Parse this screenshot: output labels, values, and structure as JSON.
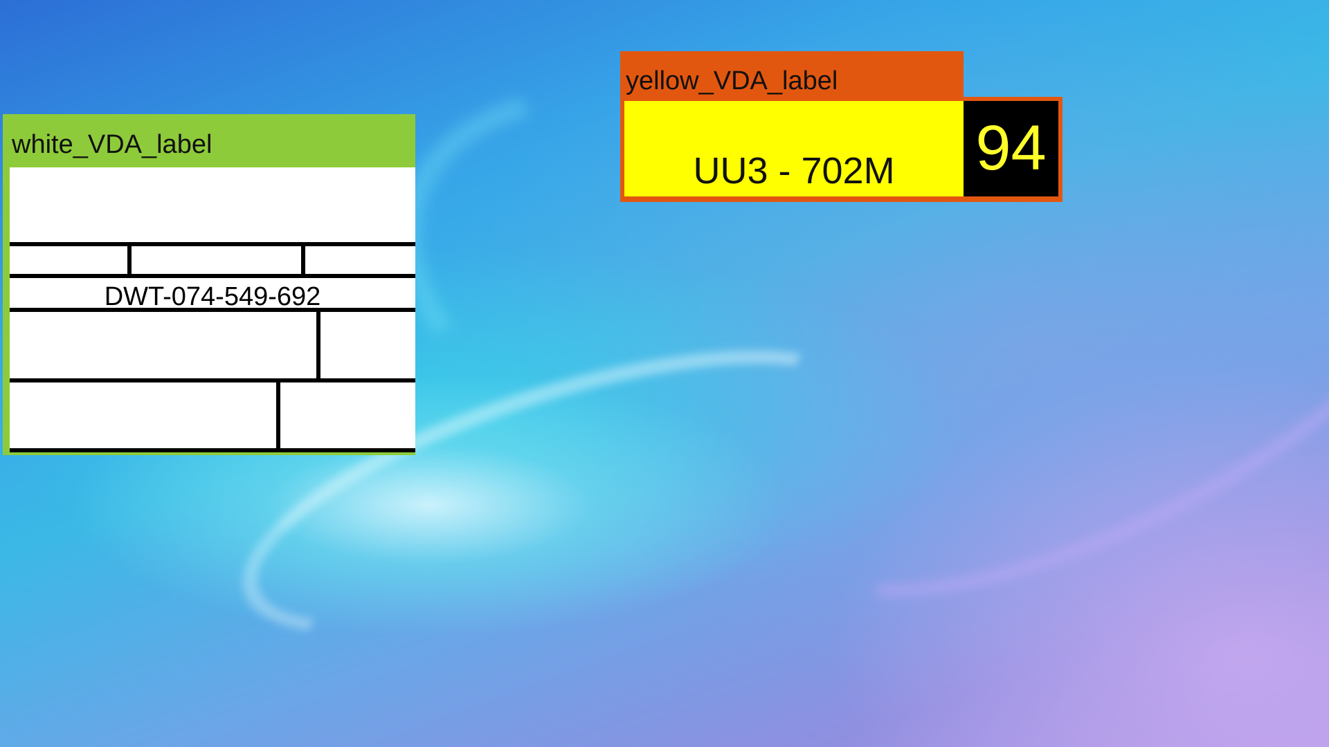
{
  "white_label": {
    "title": "white_VDA_label",
    "code": "DWT-074-549-692",
    "header_color": "#8ecb3a"
  },
  "yellow_label": {
    "title": "yellow_VDA_label",
    "plate": "UU3 - 702M",
    "number": "94",
    "header_color": "#e2570f",
    "body_color": "#ffff00"
  }
}
